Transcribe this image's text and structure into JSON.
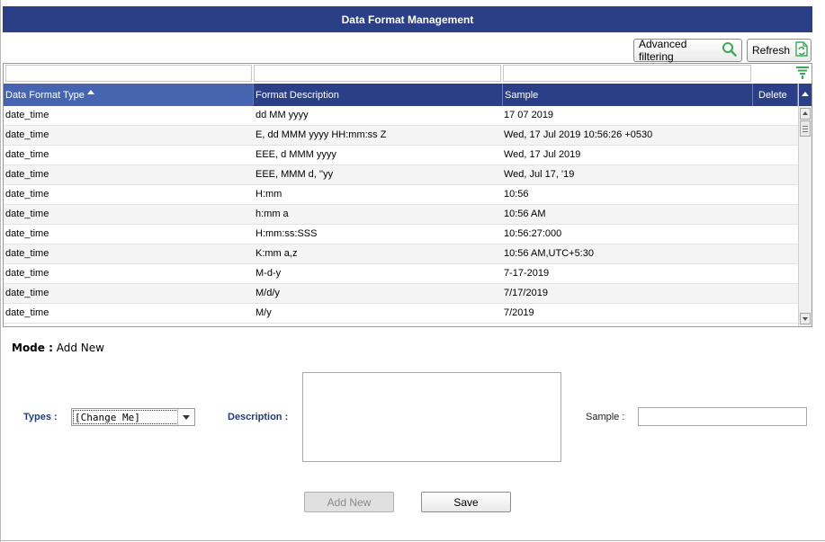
{
  "title": "Data Format Management",
  "toolbar": {
    "advanced_filtering": "Advanced filtering",
    "refresh": "Refresh"
  },
  "grid": {
    "columns": [
      "Data Format Type",
      "Format Description",
      "Sample",
      "Delete"
    ],
    "sorted_column": "Data Format Type",
    "sort_direction": "ascending",
    "rows": [
      {
        "type": "date_time",
        "description": "dd MM yyyy",
        "sample": "17 07 2019"
      },
      {
        "type": "date_time",
        "description": "E, dd MMM yyyy HH:mm:ss Z",
        "sample": "Wed, 17 Jul 2019 10:56:26 +0530"
      },
      {
        "type": "date_time",
        "description": "EEE, d MMM yyyy",
        "sample": "Wed, 17 Jul 2019"
      },
      {
        "type": "date_time",
        "description": "EEE, MMM d, ''yy",
        "sample": "Wed, Jul 17, '19"
      },
      {
        "type": "date_time",
        "description": "H:mm",
        "sample": "10:56"
      },
      {
        "type": "date_time",
        "description": "h:mm a",
        "sample": "10:56 AM"
      },
      {
        "type": "date_time",
        "description": "H:mm:ss:SSS",
        "sample": "10:56:27:000"
      },
      {
        "type": "date_time",
        "description": "K:mm a,z",
        "sample": "10:56 AM,UTC+5:30"
      },
      {
        "type": "date_time",
        "description": "M-d-y",
        "sample": "7-17-2019"
      },
      {
        "type": "date_time",
        "description": "M/d/y",
        "sample": "7/17/2019"
      },
      {
        "type": "date_time",
        "description": "M/y",
        "sample": "7/2019"
      }
    ]
  },
  "form": {
    "mode_label": "Mode :",
    "mode_value": "Add New",
    "types_label": "Types :",
    "types_value": "[Change Me]",
    "description_label": "Description :",
    "description_value": "",
    "sample_label": "Sample :",
    "sample_value": "",
    "add_new_button": "Add New",
    "save_button": "Save"
  },
  "colors": {
    "header_bg": "#2b3f86",
    "sorted_header_bg": "#4565b0",
    "label_blue": "#1f3f7a",
    "refresh_icon": "#3aa858",
    "search_icon": "#3aa858"
  }
}
